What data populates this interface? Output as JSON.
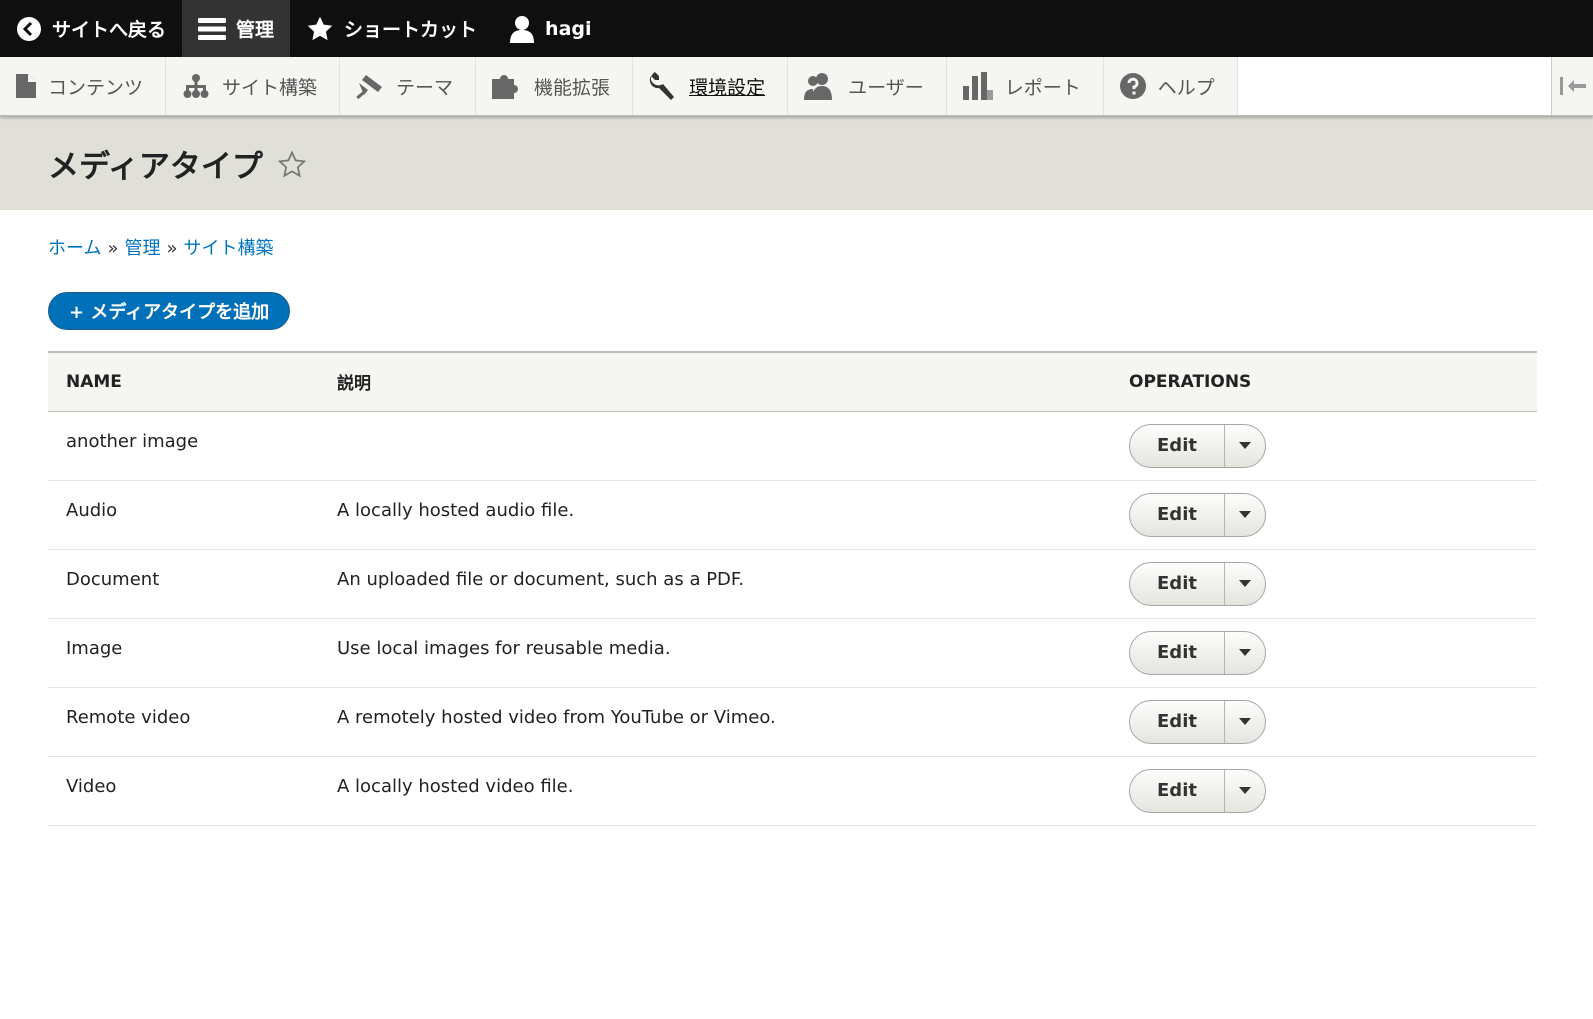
{
  "toolbar": {
    "back": "サイトへ戻る",
    "manage": "管理",
    "shortcuts": "ショートカット",
    "user": "hagi"
  },
  "tray": {
    "items": [
      {
        "label": "コンテンツ",
        "icon": "file-icon"
      },
      {
        "label": "サイト構築",
        "icon": "sitemap-icon"
      },
      {
        "label": "テーマ",
        "icon": "paint-roller-icon"
      },
      {
        "label": "機能拡張",
        "icon": "puzzle-icon"
      },
      {
        "label": "環境設定",
        "icon": "wrench-icon"
      },
      {
        "label": "ユーザー",
        "icon": "people-icon"
      },
      {
        "label": "レポート",
        "icon": "bar-chart-icon"
      },
      {
        "label": "ヘルプ",
        "icon": "help-icon"
      }
    ]
  },
  "page": {
    "title": "メディアタイプ"
  },
  "breadcrumb": {
    "home": "ホーム",
    "admin": "管理",
    "structure": "サイト構築",
    "separator": "»"
  },
  "actions": {
    "add": "+ メディアタイプを追加"
  },
  "table": {
    "headers": {
      "name": "NAME",
      "description": "説明",
      "operations": "OPERATIONS"
    },
    "rows": [
      {
        "name": "another image",
        "description": "",
        "op": "Edit"
      },
      {
        "name": "Audio",
        "description": "A locally hosted audio file.",
        "op": "Edit"
      },
      {
        "name": "Document",
        "description": "An uploaded file or document, such as a PDF.",
        "op": "Edit"
      },
      {
        "name": "Image",
        "description": "Use local images for reusable media.",
        "op": "Edit"
      },
      {
        "name": "Remote video",
        "description": "A remotely hosted video from YouTube or Vimeo.",
        "op": "Edit"
      },
      {
        "name": "Video",
        "description": "A locally hosted video file.",
        "op": "Edit"
      }
    ]
  }
}
